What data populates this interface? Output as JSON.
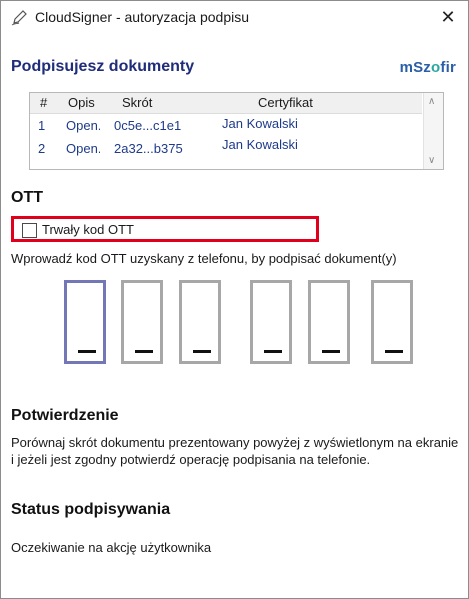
{
  "window": {
    "title": "CloudSigner - autoryzacja podpisu",
    "close_symbol": "✕",
    "icon": "signature-pen-icon"
  },
  "header": {
    "heading": "Podpisujesz dokumenty",
    "brand_main": "mSz",
    "brand_accent": "o",
    "brand_end": "fir"
  },
  "documents": {
    "columns": [
      "#",
      "Opis",
      "Skrót",
      "Certyfikat"
    ],
    "rows": [
      {
        "num": "1",
        "opis": "Open.",
        "skrot": "0c5e...c1e1",
        "cert": "Jan Kowalski"
      },
      {
        "num": "2",
        "opis": "Open.",
        "skrot": "2a32...b375",
        "cert": "Jan Kowalski"
      }
    ]
  },
  "ott": {
    "section_title": "OTT",
    "checkbox_label": "Trwały kod OTT",
    "checkbox_checked": false,
    "instruction": "Wprowadź kod OTT uzyskany z telefonu, by podpisać dokument(y)",
    "digits": [
      "",
      "",
      "",
      "",
      "",
      ""
    ]
  },
  "confirmation": {
    "title": "Potwierdzenie",
    "text": "Porównaj skrót dokumentu prezentowany powyżej z wyświetlonym na ekranie i jeżeli jest zgodny potwierdź operację podpisania na telefonie."
  },
  "status": {
    "title": "Status podpisywania",
    "text": "Oczekiwanie na akcję użytkownika"
  },
  "colors": {
    "heading": "#1f2d7a",
    "brand": "#2a5fa8",
    "brand_accent": "#2aa7a0",
    "highlight": "#e0001b",
    "active_digit": "#7377b6"
  }
}
